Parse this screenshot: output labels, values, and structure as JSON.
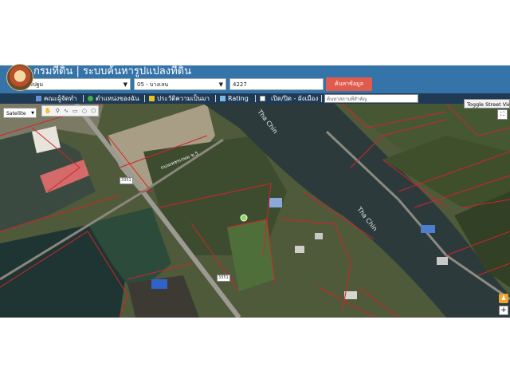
{
  "header": {
    "title": "กรมที่ดิน | ระบบค้นหารูปแปลงที่ดิน",
    "province": "นครปฐม",
    "district": "05 - บางเลน",
    "parcel_number": "4227",
    "search_button": "ค้นหาข้อมูล"
  },
  "menu": {
    "items": [
      {
        "label": "คณะผู้จัดทำ",
        "icon": "building-icon"
      },
      {
        "label": "ตำแหน่งของฉัน",
        "icon": "globe-icon"
      },
      {
        "label": "ประวัติความเป็นมา",
        "icon": "history-icon"
      },
      {
        "label": "Rating",
        "icon": "chart-icon"
      },
      {
        "label": "เปิด/ปิด - ผังเมือง",
        "icon": "checkbox-icon"
      }
    ],
    "place_search_placeholder": "ค้นหาสถานที่สำคัญ"
  },
  "map": {
    "layer": "Satellite",
    "toggle_street_view": "Toggle Street View",
    "river_label_1": "Tha Chin",
    "river_label_2": "Tha Chin",
    "road_label": "ถนนเพชรเกษม ซ.5",
    "route_shield_1": "3351",
    "route_shield_2": "3351",
    "zoom_in": "+",
    "fullscreen": "⛶"
  },
  "colors": {
    "header_bg": "#3574a8",
    "menu_bg": "#1f3a54",
    "search_button": "#e05a4e",
    "parcel_line": "#d2232a",
    "river": "#2c3a3c"
  }
}
